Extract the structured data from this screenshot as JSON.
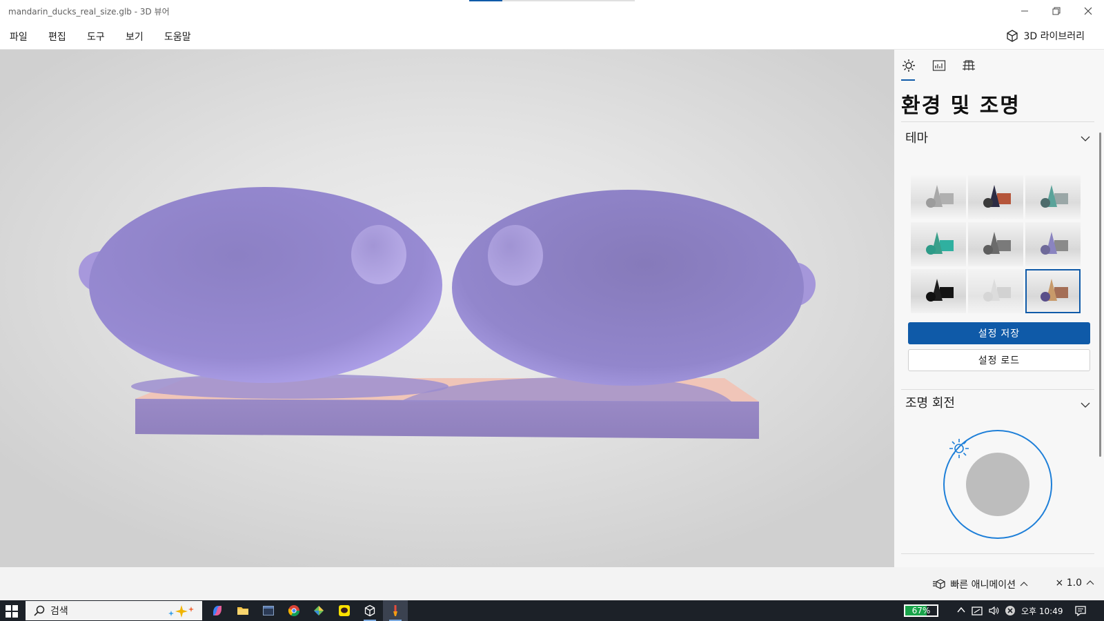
{
  "window": {
    "title": "mandarin_ducks_real_size.glb - 3D 뷰어",
    "accent_color": "#0f5aa8"
  },
  "menu": {
    "items": [
      "파일",
      "편집",
      "도구",
      "보기",
      "도움말"
    ],
    "library_label": "3D 라이브러리"
  },
  "panel": {
    "tabs": [
      "sun-icon",
      "stats-icon",
      "grid-icon"
    ],
    "title": "환경 및 조명",
    "theme_section": "테마",
    "save_label": "설정 저장",
    "load_label": "설정 로드",
    "light_section": "조명 회전",
    "selected_theme_index": 8
  },
  "statusbar": {
    "animation_label": "빠른 애니메이션",
    "speed_label": "× 1.0"
  },
  "taskbar": {
    "search_placeholder": "검색",
    "battery_label": "67%",
    "battery_level": 0.67,
    "clock": "오후 10:49"
  },
  "colors": {
    "model": "#9a8bd8",
    "base_top": "#f0c5b8",
    "panel_bg": "#f7f7f7",
    "primary_button": "#0f5aa8",
    "taskbar": "#1c2128"
  }
}
